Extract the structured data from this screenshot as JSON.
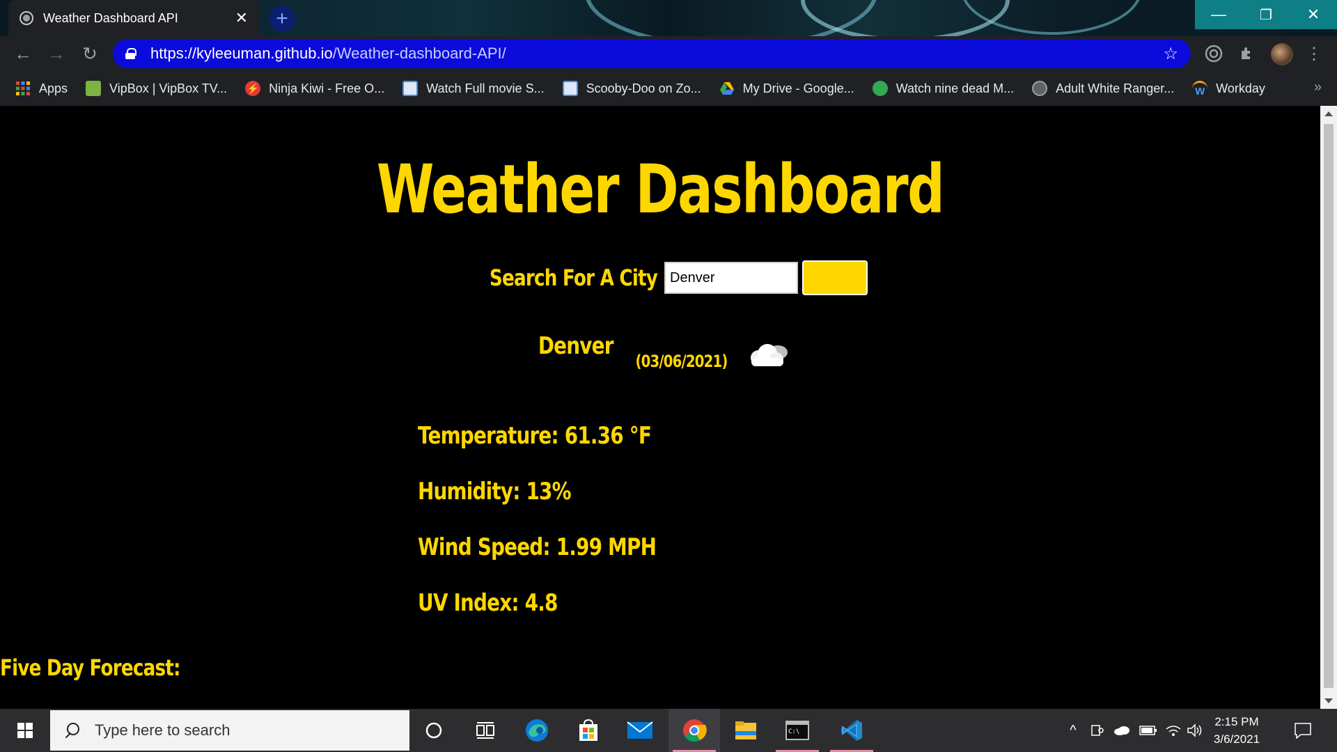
{
  "browser": {
    "tab_title": "Weather Dashboard API",
    "tab_close": "✕",
    "new_tab": "+",
    "url_host": "https://kyleeuman.github.io",
    "url_path": "/Weather-dashboard-API/",
    "window_minimize": "—",
    "window_restore": "❐",
    "window_close": "✕"
  },
  "bookmarks": [
    {
      "label": "Apps",
      "icon": "apps-grid-icon",
      "color": "#ea4335"
    },
    {
      "label": "VipBox | VipBox TV...",
      "icon": "vipbox-icon",
      "color": "#7cb342"
    },
    {
      "label": "Ninja Kiwi - Free O...",
      "icon": "ninja-kiwi-icon",
      "color": "#e53935"
    },
    {
      "label": "Watch Full movie S...",
      "icon": "movie-site-icon",
      "color": "#4a90e2"
    },
    {
      "label": "Scooby-Doo on Zo...",
      "icon": "movie-site-icon",
      "color": "#4a90e2"
    },
    {
      "label": "My Drive - Google...",
      "icon": "google-drive-icon",
      "color": "#fbbc04"
    },
    {
      "label": "Watch nine dead M...",
      "icon": "green-site-icon",
      "color": "#34a853"
    },
    {
      "label": "Adult White Ranger...",
      "icon": "globe-icon",
      "color": "#9aa0a6"
    },
    {
      "label": "Workday",
      "icon": "workday-icon",
      "color": "#f5a623"
    }
  ],
  "page": {
    "title": "Weather Dashboard",
    "search_label": "Search For A City",
    "search_value": "Denver",
    "city": "Denver",
    "date": "(03/06/2021)",
    "weather_icon": "cloud-icon",
    "temperature": "Temperature: 61.36 °F",
    "humidity": "Humidity: 13%",
    "wind_speed": "Wind Speed: 1.99 MPH",
    "uv_index": "UV Index: 4.8",
    "forecast_title": "Five Day Forecast:"
  },
  "colors": {
    "accent": "#ffd700",
    "page_background": "#000000",
    "omnibox": "#0b0bdc"
  },
  "taskbar": {
    "search_placeholder": "Type here to search",
    "time": "2:15 PM",
    "date": "3/6/2021",
    "apps": [
      "cortana-icon",
      "task-view-icon",
      "edge-icon",
      "store-icon",
      "mail-icon",
      "chrome-icon",
      "file-explorer-icon",
      "terminal-icon",
      "vscode-icon"
    ]
  }
}
